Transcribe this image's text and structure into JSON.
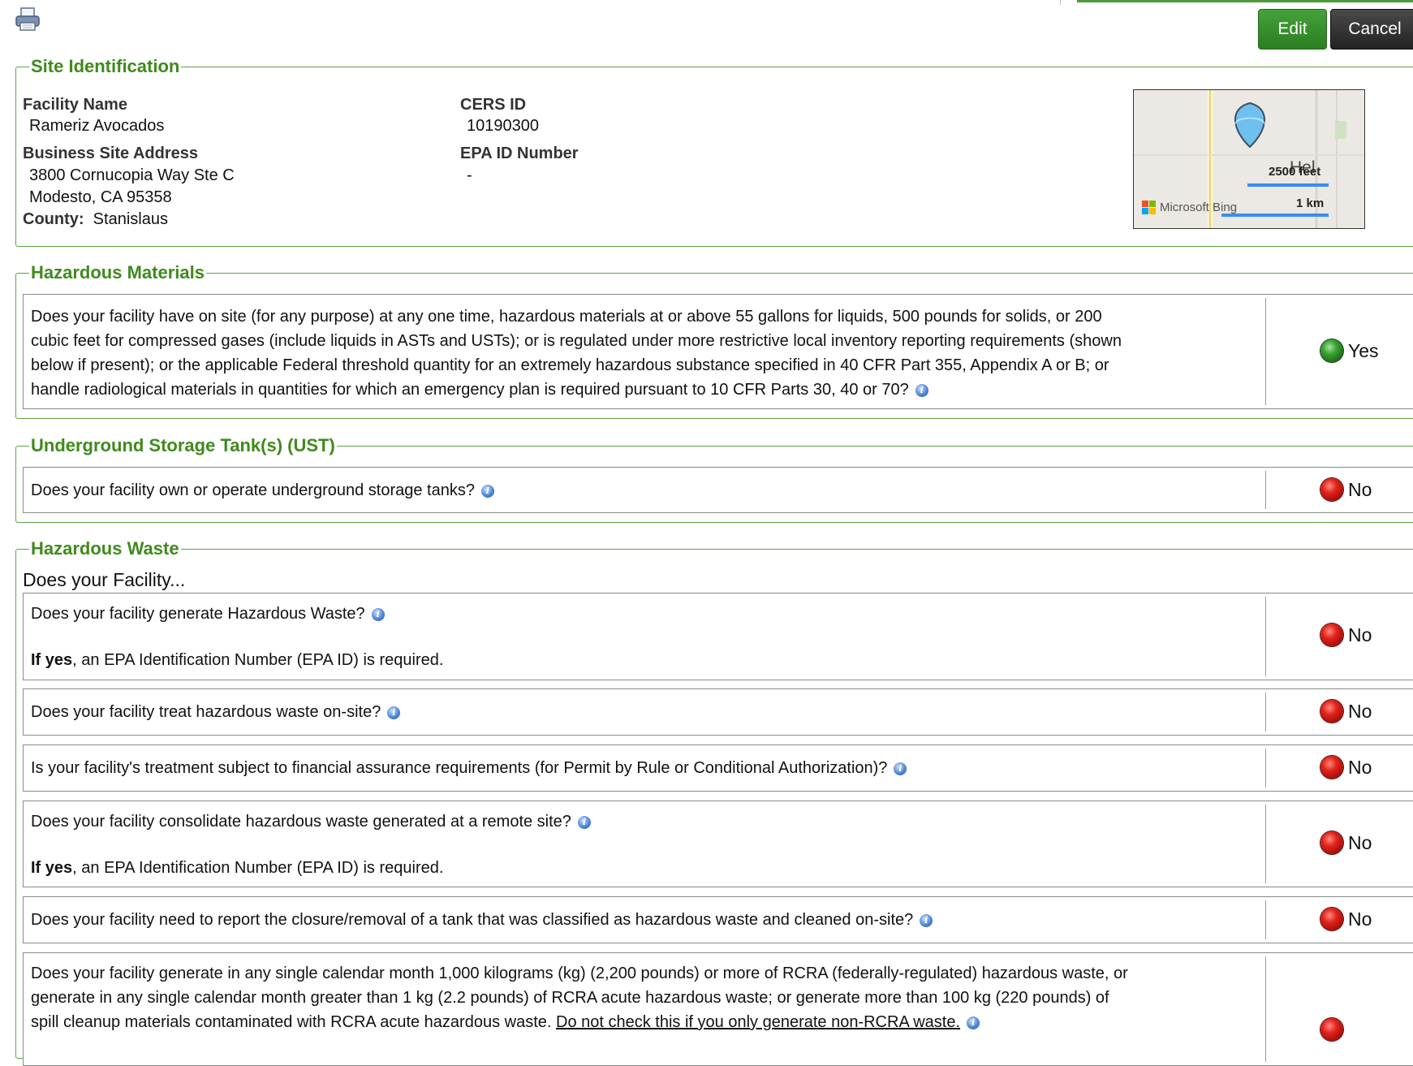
{
  "toolbar": {
    "print_icon": "printer-icon",
    "edit_label": "Edit",
    "cancel_label": "Cancel"
  },
  "site": {
    "legend": "Site Identification",
    "facility_name_label": "Facility Name",
    "facility_name": "Rameriz Avocados",
    "address_label": "Business Site Address",
    "address_line1": "3800 Cornucopia Way Ste C",
    "address_line2": "Modesto, CA 95358",
    "county_label": "County:",
    "county": "Stanislaus",
    "cers_label": "CERS ID",
    "cers_id": "10190300",
    "epa_label": "EPA ID Number",
    "epa_id": "-",
    "map": {
      "scale_feet": "2500 feet",
      "scale_km": "1 km",
      "attribution": "Microsoft Bing",
      "place": "Hel"
    }
  },
  "hazmat": {
    "legend": "Hazardous Materials",
    "question_lines": [
      "Does your facility have on site (for any purpose) at any one time, hazardous materials at or above 55 gallons for liquids, 500 pounds for solids, or 200",
      "cubic feet for compressed gases (include liquids in ASTs and USTs); or is regulated under more restrictive local inventory reporting requirements (shown",
      "below if present); or the applicable Federal threshold quantity for an extremely hazardous substance specified in 40 CFR Part 355, Appendix A or B; or",
      "handle radiological materials in quantities for which an emergency plan is required pursuant to 10 CFR Parts 30, 40 or 70?"
    ],
    "answer": "Yes"
  },
  "ust": {
    "legend": "Underground Storage Tank(s) (UST)",
    "question": "Does your facility own or operate underground storage tanks?",
    "answer": "No"
  },
  "hw": {
    "legend": "Hazardous Waste",
    "intro": "Does your Facility...",
    "if_yes_bold": "If yes",
    "if_yes_rest": ", an EPA Identification Number (EPA ID) is required.",
    "q1": "Does your facility generate Hazardous Waste?",
    "a1": "No",
    "q2": "Does your facility treat hazardous waste on-site?",
    "a2": "No",
    "q3": "Is your facility's treatment subject to financial assurance requirements (for Permit by Rule or Conditional Authorization)?",
    "a3": "No",
    "q4": "Does your facility consolidate hazardous waste generated at a remote site?",
    "a4": "No",
    "q5": "Does your facility need to report the closure/removal of a tank that was classified as hazardous waste and cleaned on-site?",
    "a5": "No",
    "q6_line1": "Does your facility generate in any single calendar month 1,000 kilograms (kg) (2,200 pounds) or more of RCRA (federally-regulated) hazardous waste, or",
    "q6_line2": "generate in any single calendar month greater than 1 kg (2.2 pounds) of RCRA acute hazardous waste; or generate more than 100 kg (220 pounds) of",
    "q6_line3": "spill cleanup materials contaminated with RCRA acute hazardous waste.",
    "q6_link": "Do not check this if you only generate non-RCRA waste."
  }
}
